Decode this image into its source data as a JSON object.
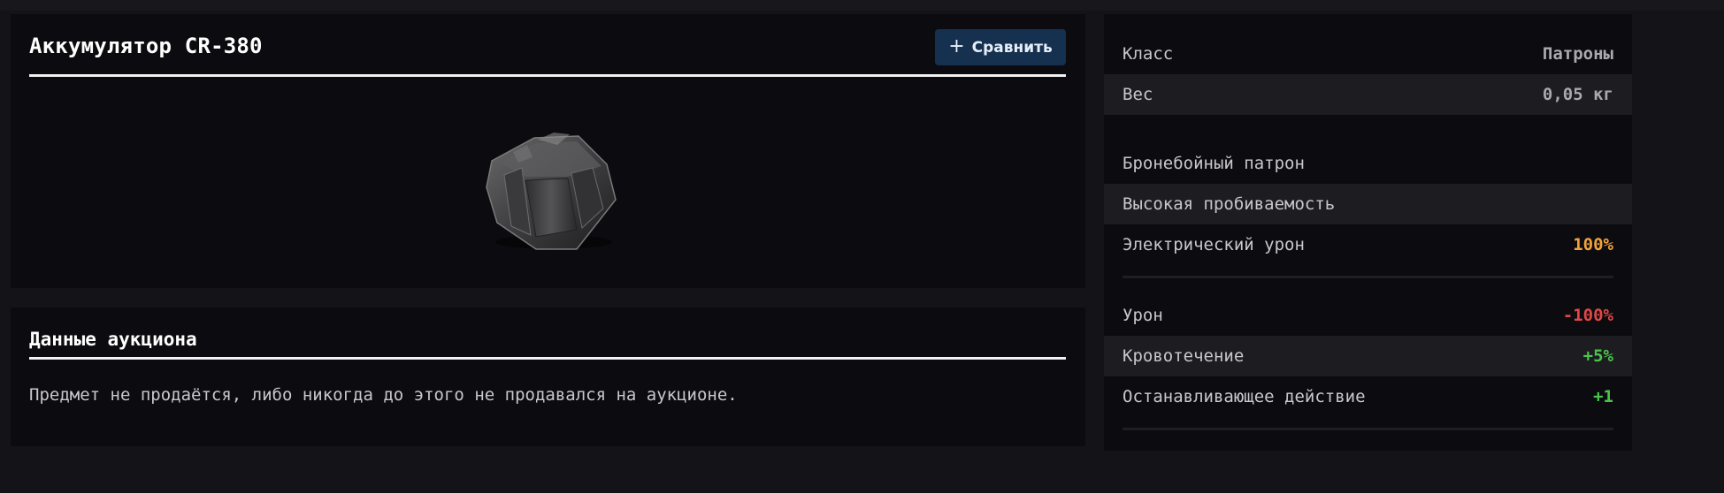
{
  "item": {
    "title": "Аккумулятор CR-380",
    "compare_label": "Сравнить",
    "compare_icon": "plus-icon",
    "image_icon": "battery-icon"
  },
  "auction": {
    "title": "Данные аукциона",
    "text": "Предмет не продаётся, либо никогда до этого не продавался на аукционе."
  },
  "stats": {
    "class": {
      "label": "Класс",
      "value": "Патроны"
    },
    "weight": {
      "label": "Вес",
      "value": "0,05 кг"
    },
    "properties": [
      {
        "label": "Бронебойный патрон",
        "value": ""
      },
      {
        "label": "Высокая пробиваемость",
        "value": ""
      },
      {
        "label": "Электрический урон",
        "value": "100%",
        "color": "#f2a23a"
      }
    ],
    "modifiers": [
      {
        "label": "Урон",
        "value": "-100%",
        "color": "#e04848"
      },
      {
        "label": "Кровотечение",
        "value": "+5%",
        "color": "#4ac54a"
      },
      {
        "label": "Останавливающее действие",
        "value": "+1",
        "color": "#4ac54a"
      }
    ]
  },
  "colors": {
    "background": "#141418",
    "panel": "#0c0c10",
    "compare_button": "#16304f"
  }
}
